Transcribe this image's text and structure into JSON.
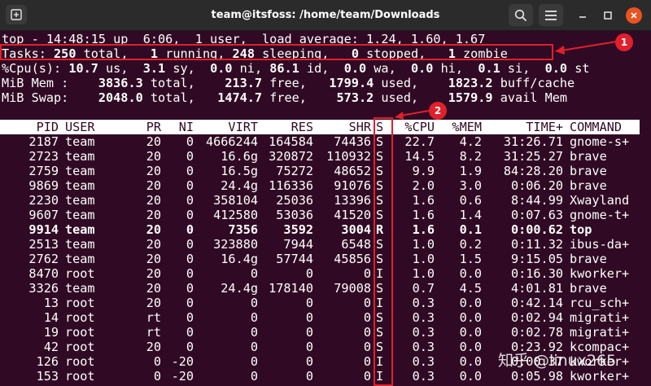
{
  "window": {
    "title": "team@itsfoss: /home/team/Downloads",
    "accent_close": "#e95420"
  },
  "top": {
    "uptime_line": "top - 14:48:15 up  6:06,  1 user,  load average: 1.24, 1.60, 1.67",
    "tasks": {
      "label": "Tasks:",
      "total": "250",
      "total_lbl": " total,",
      "running": "1",
      "running_lbl": " running,",
      "sleeping": "248",
      "sleeping_lbl": " sleeping,",
      "stopped": "0",
      "stopped_lbl": " stopped,",
      "zombie": "1",
      "zombie_lbl": " zombie"
    },
    "cpu": {
      "label": "%Cpu(s):",
      "us": "10.7",
      "sy": "3.1",
      "ni": "0.0",
      "id": "86.1",
      "wa": "0.0",
      "hi": "0.0",
      "si": "0.1",
      "st": "0.0"
    },
    "mem": {
      "label": "MiB Mem :",
      "total": "3836.3",
      "free": "213.7",
      "used": "1799.4",
      "buff_cache": "1823.2"
    },
    "swap": {
      "label": "MiB Swap:",
      "total": "2048.0",
      "free": "1474.7",
      "used": "573.2",
      "avail": "1579.9"
    },
    "units": {
      "us": " us,",
      "sy": " sy,",
      "ni": " ni,",
      "id": " id,",
      "wa": " wa,",
      "hi": " hi,",
      "si": " si,",
      "st": " st",
      "total": " total,",
      "free": " free,",
      "used": " used,",
      "buff": " buff/cache",
      "avail": " avail Mem"
    }
  },
  "columns": [
    "PID",
    "USER",
    "PR",
    "NI",
    "VIRT",
    "RES",
    "SHR",
    "S",
    "%CPU",
    "%MEM",
    "TIME+",
    "COMMAND"
  ],
  "processes": [
    {
      "pid": "2187",
      "user": "team",
      "pr": "20",
      "ni": "0",
      "virt": "4666244",
      "res": "164584",
      "shr": "74436",
      "s": "S",
      "cpu": "22.7",
      "mem": "4.2",
      "time": "31:26.71",
      "cmd": "gnome-s+",
      "bold": false
    },
    {
      "pid": "2723",
      "user": "team",
      "pr": "20",
      "ni": "0",
      "virt": "16.6g",
      "res": "320872",
      "shr": "110932",
      "s": "S",
      "cpu": "14.5",
      "mem": "8.2",
      "time": "31:25.27",
      "cmd": "brave",
      "bold": false
    },
    {
      "pid": "2759",
      "user": "team",
      "pr": "20",
      "ni": "0",
      "virt": "16.5g",
      "res": "75272",
      "shr": "48652",
      "s": "S",
      "cpu": "9.9",
      "mem": "1.9",
      "time": "84:28.20",
      "cmd": "brave",
      "bold": false
    },
    {
      "pid": "9869",
      "user": "team",
      "pr": "20",
      "ni": "0",
      "virt": "24.4g",
      "res": "116336",
      "shr": "91076",
      "s": "S",
      "cpu": "2.0",
      "mem": "3.0",
      "time": "0:06.20",
      "cmd": "brave",
      "bold": false
    },
    {
      "pid": "2230",
      "user": "team",
      "pr": "20",
      "ni": "0",
      "virt": "358104",
      "res": "25036",
      "shr": "13396",
      "s": "S",
      "cpu": "1.6",
      "mem": "0.6",
      "time": "8:44.99",
      "cmd": "Xwayland",
      "bold": false
    },
    {
      "pid": "9607",
      "user": "team",
      "pr": "20",
      "ni": "0",
      "virt": "412580",
      "res": "53036",
      "shr": "41520",
      "s": "S",
      "cpu": "1.6",
      "mem": "1.4",
      "time": "0:07.63",
      "cmd": "gnome-t+",
      "bold": false
    },
    {
      "pid": "9914",
      "user": "team",
      "pr": "20",
      "ni": "0",
      "virt": "7356",
      "res": "3592",
      "shr": "3004",
      "s": "R",
      "cpu": "1.6",
      "mem": "0.1",
      "time": "0:00.62",
      "cmd": "top",
      "bold": true
    },
    {
      "pid": "2513",
      "user": "team",
      "pr": "20",
      "ni": "0",
      "virt": "323880",
      "res": "7944",
      "shr": "6548",
      "s": "S",
      "cpu": "1.0",
      "mem": "0.2",
      "time": "0:11.32",
      "cmd": "ibus-da+",
      "bold": false
    },
    {
      "pid": "2762",
      "user": "team",
      "pr": "20",
      "ni": "0",
      "virt": "16.4g",
      "res": "57744",
      "shr": "45856",
      "s": "S",
      "cpu": "1.0",
      "mem": "1.5",
      "time": "9:15.05",
      "cmd": "brave",
      "bold": false
    },
    {
      "pid": "8470",
      "user": "root",
      "pr": "20",
      "ni": "0",
      "virt": "0",
      "res": "0",
      "shr": "0",
      "s": "I",
      "cpu": "1.0",
      "mem": "0.0",
      "time": "0:16.30",
      "cmd": "kworker+",
      "bold": false
    },
    {
      "pid": "3326",
      "user": "team",
      "pr": "20",
      "ni": "0",
      "virt": "24.4g",
      "res": "178140",
      "shr": "79008",
      "s": "S",
      "cpu": "0.7",
      "mem": "4.5",
      "time": "4:01.81",
      "cmd": "brave",
      "bold": false
    },
    {
      "pid": "13",
      "user": "root",
      "pr": "20",
      "ni": "0",
      "virt": "0",
      "res": "0",
      "shr": "0",
      "s": "I",
      "cpu": "0.3",
      "mem": "0.0",
      "time": "0:42.14",
      "cmd": "rcu_sch+",
      "bold": false
    },
    {
      "pid": "14",
      "user": "root",
      "pr": "rt",
      "ni": "0",
      "virt": "0",
      "res": "0",
      "shr": "0",
      "s": "S",
      "cpu": "0.3",
      "mem": "0.0",
      "time": "0:02.94",
      "cmd": "migrati+",
      "bold": false
    },
    {
      "pid": "19",
      "user": "root",
      "pr": "rt",
      "ni": "0",
      "virt": "0",
      "res": "0",
      "shr": "0",
      "s": "S",
      "cpu": "0.3",
      "mem": "0.0",
      "time": "0:02.78",
      "cmd": "migrati+",
      "bold": false
    },
    {
      "pid": "42",
      "user": "root",
      "pr": "20",
      "ni": "0",
      "virt": "0",
      "res": "0",
      "shr": "0",
      "s": "S",
      "cpu": "0.3",
      "mem": "0.0",
      "time": "0:23.92",
      "cmd": "kcompac+",
      "bold": false
    },
    {
      "pid": "126",
      "user": "root",
      "pr": "0",
      "ni": "-20",
      "virt": "0",
      "res": "0",
      "shr": "0",
      "s": "I",
      "cpu": "0.3",
      "mem": "0.0",
      "time": "0:00.37",
      "cmd": "kworker+",
      "bold": false
    },
    {
      "pid": "153",
      "user": "root",
      "pr": "0",
      "ni": "-20",
      "virt": "0",
      "res": "0",
      "shr": "0",
      "s": "I",
      "cpu": "0.3",
      "mem": "0.0",
      "time": "0:05.98",
      "cmd": "kworker+",
      "bold": false
    }
  ],
  "annotations": {
    "badge1": "1",
    "badge2": "2",
    "color": "#e0202a"
  },
  "watermark": "知乎 @linux265",
  "icons": {
    "new_tab": "new-tab-icon",
    "search": "search-icon",
    "menu": "hamburger-menu-icon",
    "minimize": "minimize-icon",
    "maximize": "maximize-icon",
    "close": "close-icon"
  }
}
